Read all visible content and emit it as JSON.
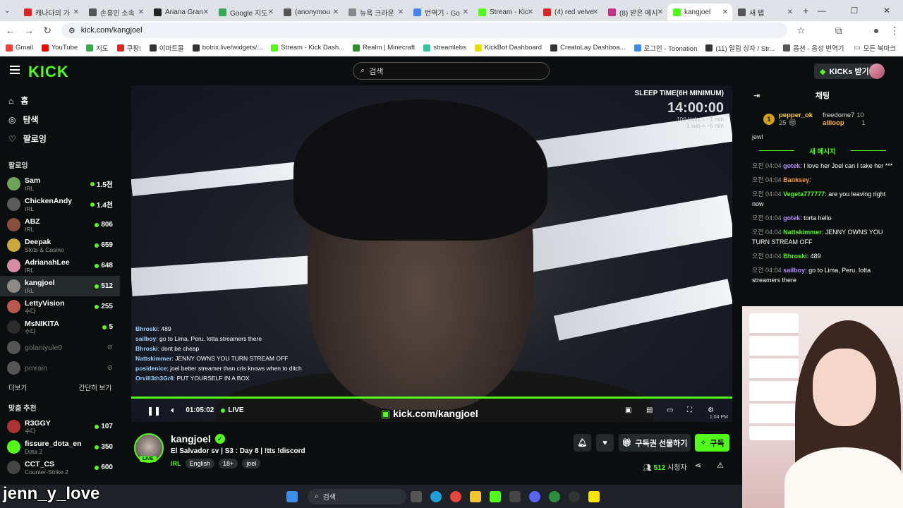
{
  "browser": {
    "tabs": [
      {
        "label": "캐나다의 가",
        "color": "#e02424"
      },
      {
        "label": "손흥민 소속",
        "color": "#555555"
      },
      {
        "label": "Ariana Gran",
        "color": "#222222"
      },
      {
        "label": "Google 지도",
        "color": "#34a853"
      },
      {
        "label": "(anonymou",
        "color": "#555555"
      },
      {
        "label": "뉴욕 크라운",
        "color": "#888888"
      },
      {
        "label": "번역기 - Go",
        "color": "#4285f4"
      },
      {
        "label": "Stream - Kic",
        "color": "#53fc18"
      },
      {
        "label": "(4) red velve",
        "color": "#e02424"
      },
      {
        "label": "(8) 받은 메시",
        "color": "#c13584"
      },
      {
        "label": "kangjoel",
        "color": "#53fc18"
      },
      {
        "label": "새 탭",
        "color": "#555555"
      }
    ],
    "url": "kick.com/kangjoel",
    "bookmarks": [
      {
        "label": "Gmail",
        "color": "#ea4335"
      },
      {
        "label": "YouTube",
        "color": "#ff0000"
      },
      {
        "label": "지도",
        "color": "#34a853"
      },
      {
        "label": "쿠팡!",
        "color": "#e02424"
      },
      {
        "label": "이마트몰",
        "color": "#333333"
      },
      {
        "label": "botrix.live/widgets/...",
        "color": "#333333"
      },
      {
        "label": "Stream - Kick Dash...",
        "color": "#53fc18"
      },
      {
        "label": "Realm | Minecraft",
        "color": "#2d8f2d"
      },
      {
        "label": "streamlebs",
        "color": "#31c3a2"
      },
      {
        "label": "KickBot Dashboard",
        "color": "#e8e000"
      },
      {
        "label": "CreatoLay Dashboa...",
        "color": "#333333"
      },
      {
        "label": "로그인 - Toonation",
        "color": "#3b8eea"
      },
      {
        "label": "(11) 알림 상자 / Str...",
        "color": "#333333"
      },
      {
        "label": "옵션 - 음성 번역기",
        "color": "#555555"
      }
    ],
    "bookmarks_all": "모든 북마크"
  },
  "header": {
    "logo": "KICK",
    "search_placeholder": "검색",
    "kicks_button": "KICKs 받기"
  },
  "sidebar": {
    "nav": [
      {
        "label": "홈",
        "icon": "home-icon"
      },
      {
        "label": "탐색",
        "icon": "compass-icon"
      },
      {
        "label": "팔로잉",
        "icon": "heart-icon"
      }
    ],
    "following_title": "팔로잉",
    "following": [
      {
        "name": "Sam",
        "category": "IRL",
        "viewers": "1.5천",
        "color": "#6fa35a"
      },
      {
        "name": "ChickenAndy",
        "category": "IRL",
        "viewers": "1.4천",
        "color": "#5b5b5b"
      },
      {
        "name": "ABZ",
        "category": "IRL",
        "viewers": "806",
        "color": "#8a4f3c"
      },
      {
        "name": "Deepak",
        "category": "Slots & Casino",
        "viewers": "659",
        "color": "#c9a93c"
      },
      {
        "name": "AdrianahLee",
        "category": "IRL",
        "viewers": "648",
        "color": "#d68aa3"
      },
      {
        "name": "kangjoel",
        "category": "IRL",
        "viewers": "512",
        "color": "#8d8a86"
      },
      {
        "name": "LettyVision",
        "category": "수다",
        "viewers": "255",
        "color": "#b8584e"
      },
      {
        "name": "MsNIKITA",
        "category": "수다",
        "viewers": "5",
        "color": "#2c2c2c"
      }
    ],
    "offline": [
      {
        "name": "golaniyule0"
      },
      {
        "name": "pmrain"
      }
    ],
    "more_label": "더보기",
    "collapse_label": "간단히 보기",
    "recommended_title": "맞춤 추천",
    "recommended": [
      {
        "name": "R3GGY",
        "category": "수다",
        "viewers": "107",
        "color": "#a33"
      },
      {
        "name": "fissure_dota_en",
        "category": "Dota 2",
        "viewers": "350",
        "color": "#53fc18"
      },
      {
        "name": "CCT_CS",
        "category": "Counter-Strike 2",
        "viewers": "600",
        "color": "#444"
      }
    ]
  },
  "player": {
    "overlay_title": "SLEEP TIME(6H MINIMUM)",
    "overlay_timer": "14:00:00",
    "overlay_line1": "100 kicks = ~1 min",
    "overlay_line2": "1 sub = ~5 min",
    "chat_overlay": [
      {
        "user": "Bhroski",
        "text": "489"
      },
      {
        "user": "sailboy",
        "text": "go to Lima, Peru. lotta streamers there"
      },
      {
        "user": "Bhroski",
        "text": "dont be cheap"
      },
      {
        "user": "Nattskimmer",
        "text": "JENNY OWNS YOU TURN STREAM OFF"
      },
      {
        "user": "posidenice",
        "text": "joel better streamer than cris knows when to ditch"
      },
      {
        "user": "Orvill3th3Gr8",
        "text": "PUT YOURSELF IN A BOX"
      }
    ],
    "time": "01:05:02",
    "live": "LIVE",
    "watermark": "kick.com/kangjoel",
    "clock": "1:04 PM"
  },
  "stream_info": {
    "name": "kangjoel",
    "live_badge": "LIVE",
    "title": "El Salvador sv | S3 : Day 8 | !tts !discord",
    "category": "IRL",
    "tags": [
      "English",
      "18+",
      "joel"
    ],
    "gift_sub": "구독권 선물하기",
    "subscribe": "구독",
    "viewers": "512",
    "viewers_label": "시청자"
  },
  "chat": {
    "title": "채팅",
    "gifters": [
      {
        "rank": "1",
        "name": "pepper_ok",
        "count": "25"
      },
      {
        "name": "freedome7",
        "count": "10"
      },
      {
        "name": "allioop",
        "count": "1"
      }
    ],
    "partial_user": "jewl",
    "new_messages": "새 메시지",
    "messages": [
      {
        "time": "오전 04:04",
        "user": "gotek",
        "color": "#b98cff",
        "text": "I love her Joel can I take her ***"
      },
      {
        "time": "오전 04:04",
        "user": "Banksey",
        "color": "#ff9d3b",
        "text": ""
      },
      {
        "time": "오전 04:04",
        "user": "Vegeta777777",
        "color": "#53fc18",
        "text": "are you leaving right now"
      },
      {
        "time": "오전 04:04",
        "user": "gotek",
        "color": "#b98cff",
        "text": "torta hello"
      },
      {
        "time": "오전 04:04",
        "user": "Nattskimmer",
        "color": "#53fc18",
        "text": "JENNY OWNS YOU TURN STREAM OFF"
      },
      {
        "time": "오전 04:04",
        "user": "Bhroski",
        "color": "#53fc18",
        "text": "489"
      },
      {
        "time": "오전 04:04",
        "user": "sailboy",
        "color": "#b98cff",
        "text": "go to Lima, Peru. lotta streamers there"
      }
    ]
  },
  "taskbar": {
    "search": "검색"
  },
  "overlay_name": "jenn_y_love"
}
